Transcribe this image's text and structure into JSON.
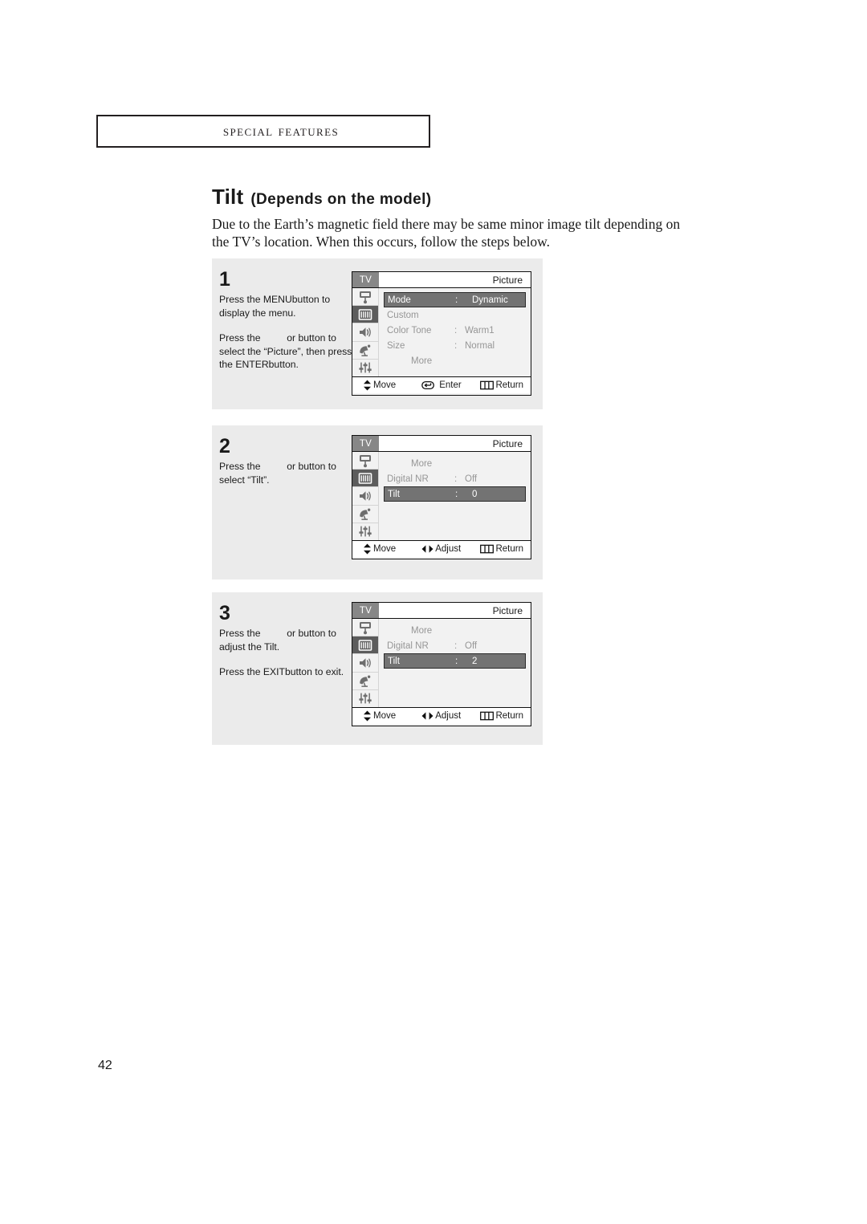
{
  "header": {
    "section_label": "Special Features"
  },
  "title": {
    "main": "Tilt",
    "sub": "(Depends on the model)"
  },
  "intro": "Due to the Earth’s magnetic field there may be same minor image tilt depending on the TV’s location. When this occurs, follow the steps below.",
  "page_number": "42",
  "colors": {
    "panel_background": "#ebebeb",
    "osd_background": "#f2f2f2",
    "osd_highlight": "#737373",
    "osd_dim_text": "#969696",
    "osd_tab": "#878787",
    "rail_active": "#5c5c5c",
    "ink": "#1a1a1a"
  },
  "steps": [
    {
      "number": "1",
      "paragraphs": [
        {
          "parts": [
            "Press the MENU",
            "button to display the menu."
          ]
        },
        {
          "parts": [
            "Press the ",
            " or ",
            " button to select the “Picture”, then press the ENTER",
            "button."
          ]
        }
      ],
      "osd": {
        "tv_label": "TV",
        "title": "Picture",
        "rail_icons": [
          "input-source-icon",
          "picture-icon",
          "sound-icon",
          "channel-dish-icon",
          "setup-sliders-icon"
        ],
        "rail_active_index": 1,
        "rows": [
          {
            "label": "Mode",
            "colon": ":",
            "value": "Dynamic",
            "highlight": true,
            "indent": false
          },
          {
            "label": "Custom",
            "colon": "",
            "value": "",
            "highlight": false,
            "indent": false
          },
          {
            "label": "Color Tone",
            "colon": ":",
            "value": "Warm1",
            "highlight": false,
            "indent": false
          },
          {
            "label": "Size",
            "colon": ":",
            "value": "Normal",
            "highlight": false,
            "indent": false
          },
          {
            "label": "More",
            "colon": "",
            "value": "",
            "highlight": false,
            "indent": true
          }
        ],
        "bottom": [
          {
            "icon": "up-down-arrows-icon",
            "label": "Move"
          },
          {
            "icon": "enter-key-icon",
            "label": "Enter"
          },
          {
            "icon": "return-bars-icon",
            "label": "Return"
          }
        ]
      }
    },
    {
      "number": "2",
      "paragraphs": [
        {
          "parts": [
            "Press the ",
            " or ",
            " button to select “Tilt”."
          ]
        }
      ],
      "osd": {
        "tv_label": "TV",
        "title": "Picture",
        "rail_icons": [
          "input-source-icon",
          "picture-icon",
          "sound-icon",
          "channel-dish-icon",
          "setup-sliders-icon"
        ],
        "rail_active_index": 1,
        "rows": [
          {
            "label": "More",
            "colon": "",
            "value": "",
            "highlight": false,
            "indent": true
          },
          {
            "label": "Digital NR",
            "colon": ":",
            "value": "Off",
            "highlight": false,
            "indent": false
          },
          {
            "label": "Tilt",
            "colon": ":",
            "value": "0",
            "highlight": true,
            "indent": false
          }
        ],
        "bottom": [
          {
            "icon": "up-down-arrows-icon",
            "label": "Move"
          },
          {
            "icon": "left-right-arrows-icon",
            "label": "Adjust"
          },
          {
            "icon": "return-bars-icon",
            "label": "Return"
          }
        ]
      }
    },
    {
      "number": "3",
      "paragraphs": [
        {
          "parts": [
            "Press the ",
            " or ",
            " button to adjust the Tilt."
          ]
        },
        {
          "parts": [
            "Press the EXIT",
            "button to exit."
          ]
        }
      ],
      "osd": {
        "tv_label": "TV",
        "title": "Picture",
        "rail_icons": [
          "input-source-icon",
          "picture-icon",
          "sound-icon",
          "channel-dish-icon",
          "setup-sliders-icon"
        ],
        "rail_active_index": 1,
        "rows": [
          {
            "label": "More",
            "colon": "",
            "value": "",
            "highlight": false,
            "indent": true
          },
          {
            "label": "Digital NR",
            "colon": ":",
            "value": "Off",
            "highlight": false,
            "indent": false
          },
          {
            "label": "Tilt",
            "colon": ":",
            "value": "2",
            "highlight": true,
            "indent": false
          }
        ],
        "bottom": [
          {
            "icon": "up-down-arrows-icon",
            "label": "Move"
          },
          {
            "icon": "left-right-arrows-icon",
            "label": "Adjust"
          },
          {
            "icon": "return-bars-icon",
            "label": "Return"
          }
        ]
      }
    }
  ]
}
